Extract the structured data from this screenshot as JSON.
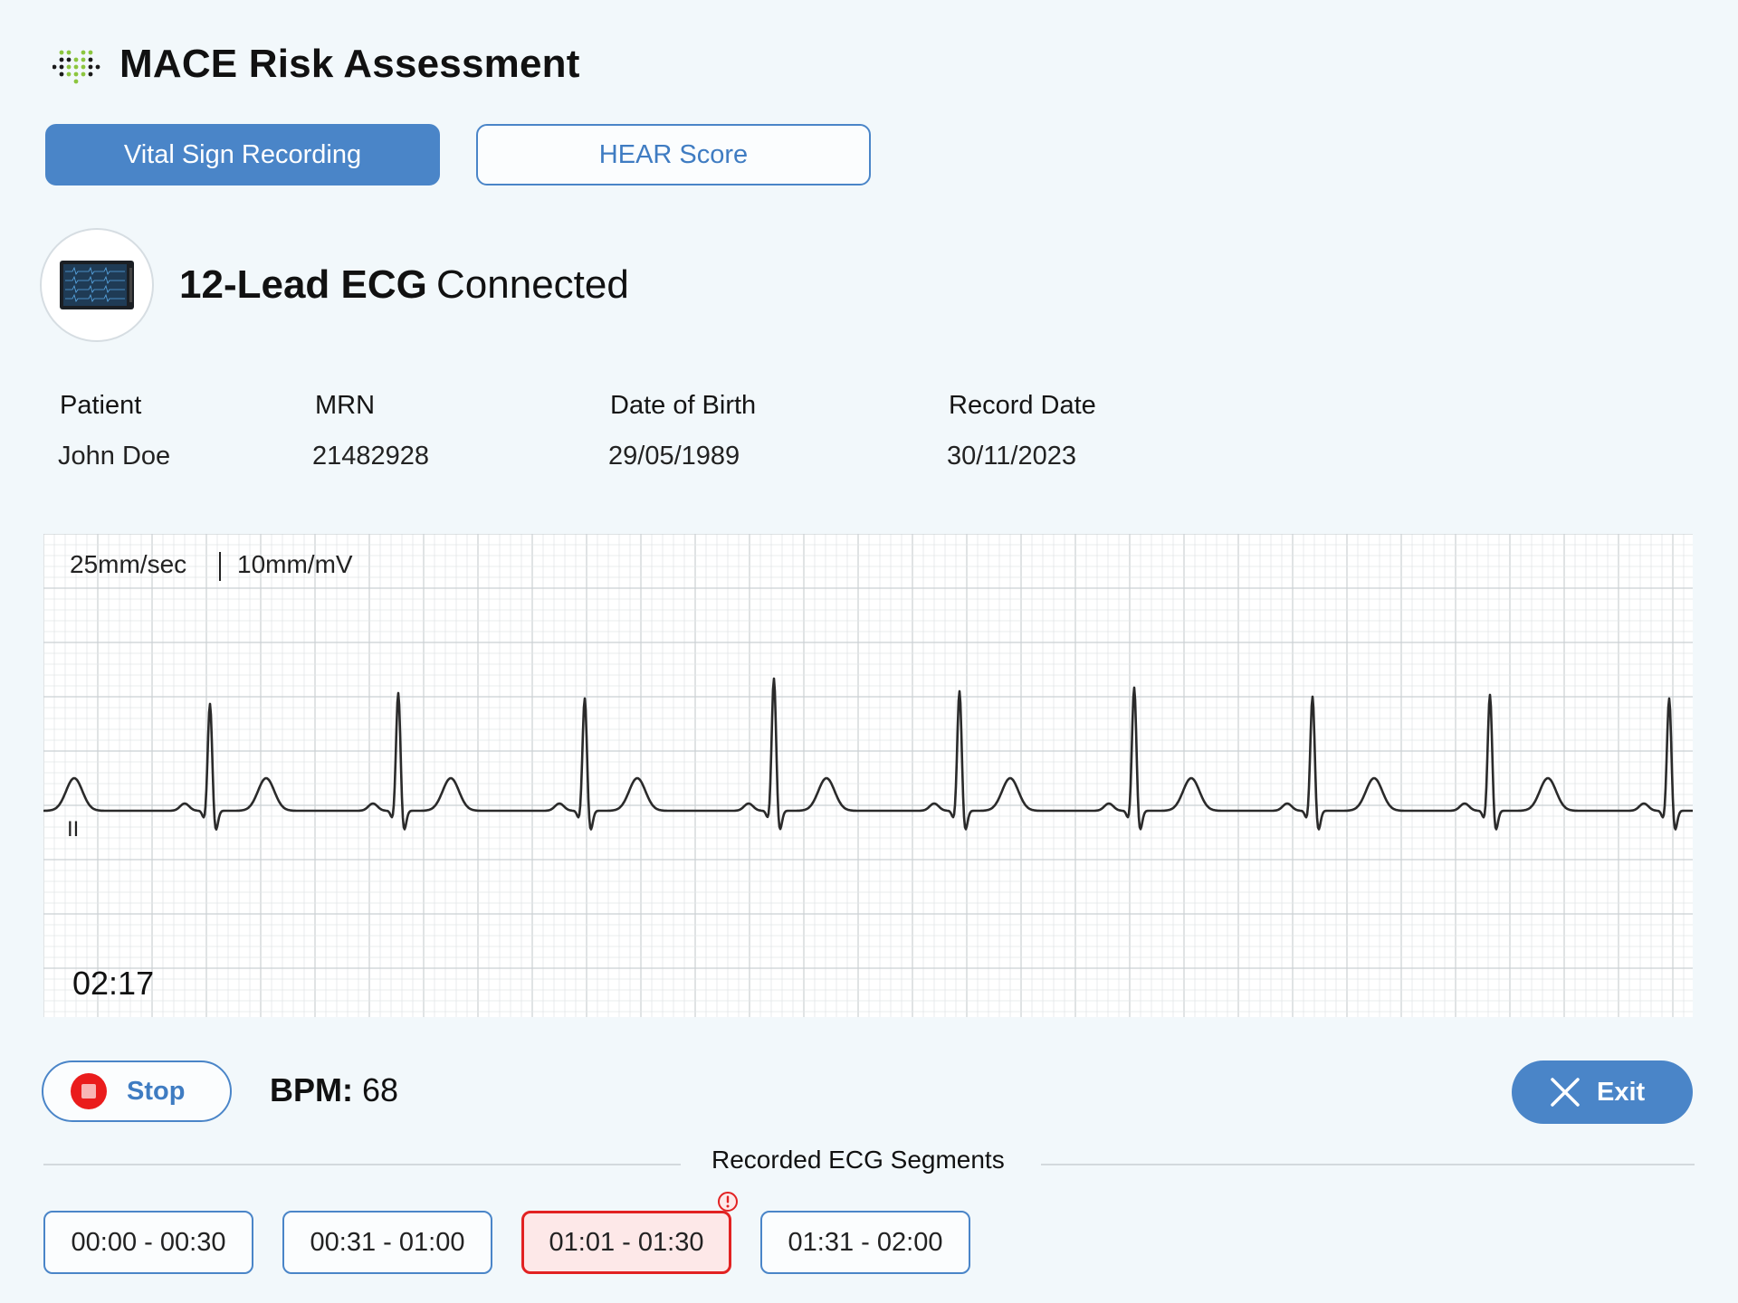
{
  "app": {
    "title": "MACE Risk Assessment"
  },
  "tabs": [
    {
      "label": "Vital Sign Recording",
      "active": true
    },
    {
      "label": "HEAR Score",
      "active": false
    }
  ],
  "device": {
    "name": "12-Lead ECG",
    "status": "Connected"
  },
  "patient_info": {
    "labels": {
      "patient": "Patient",
      "mrn": "MRN",
      "dob": "Date of Birth",
      "record_date": "Record Date"
    },
    "values": {
      "patient": "John Doe",
      "mrn": "21482928",
      "dob": "29/05/1989",
      "record_date": "30/11/2023"
    }
  },
  "ecg": {
    "speed": "25mm/sec",
    "gain": "10mm/mV",
    "lead": "II",
    "elapsed": "02:17",
    "trace_color": "#2a2a2a",
    "grid_minor_color": "#e3e6e8",
    "grid_major_color": "#cbd0d3"
  },
  "controls": {
    "stop_label": "Stop",
    "bpm_label": "BPM:",
    "bpm_value": "68",
    "exit_label": "Exit"
  },
  "segments": {
    "title": "Recorded ECG Segments",
    "items": [
      {
        "label": "00:00 - 00:30",
        "warning": false
      },
      {
        "label": "00:31 - 01:00",
        "warning": false
      },
      {
        "label": "01:01 - 01:30",
        "warning": true
      },
      {
        "label": "01:31 - 02:00",
        "warning": false
      }
    ]
  },
  "colors": {
    "accent": "#4a85c8",
    "background": "#f2f8fb",
    "stop_red": "#ea1c1c",
    "warning_red": "#e22222"
  }
}
